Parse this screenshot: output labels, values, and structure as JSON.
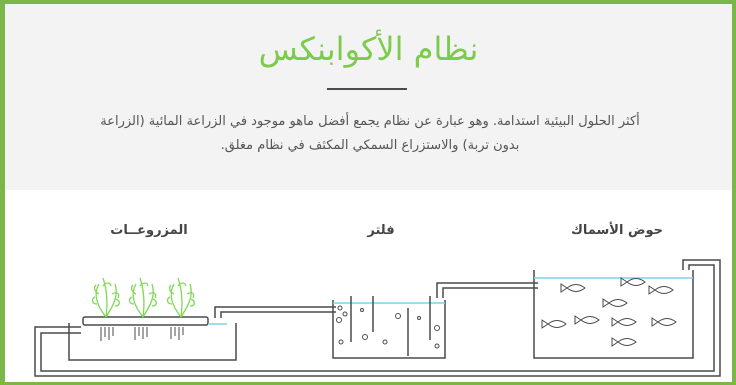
{
  "title": "نظام الأكوابنكس",
  "intro": "أكثر الحلول البيئية استدامة. وهو عبارة عن نظام يجمع أفضل ماهو موجود في الزراعة المائية (الزراعة بدون تربة) والاستزراع السمكي المكثف في نظام مغلق.",
  "diagram": {
    "labels": {
      "fish_tank": "حوض الأسماك",
      "filter": "فلتر",
      "plants": "المزروعــات"
    }
  },
  "colors": {
    "accent_green": "#7ab648",
    "title_green": "#7ccb4d",
    "water_line": "#7fd3e6",
    "plant_green": "#7ed957",
    "outline": "#4a4a4a"
  }
}
